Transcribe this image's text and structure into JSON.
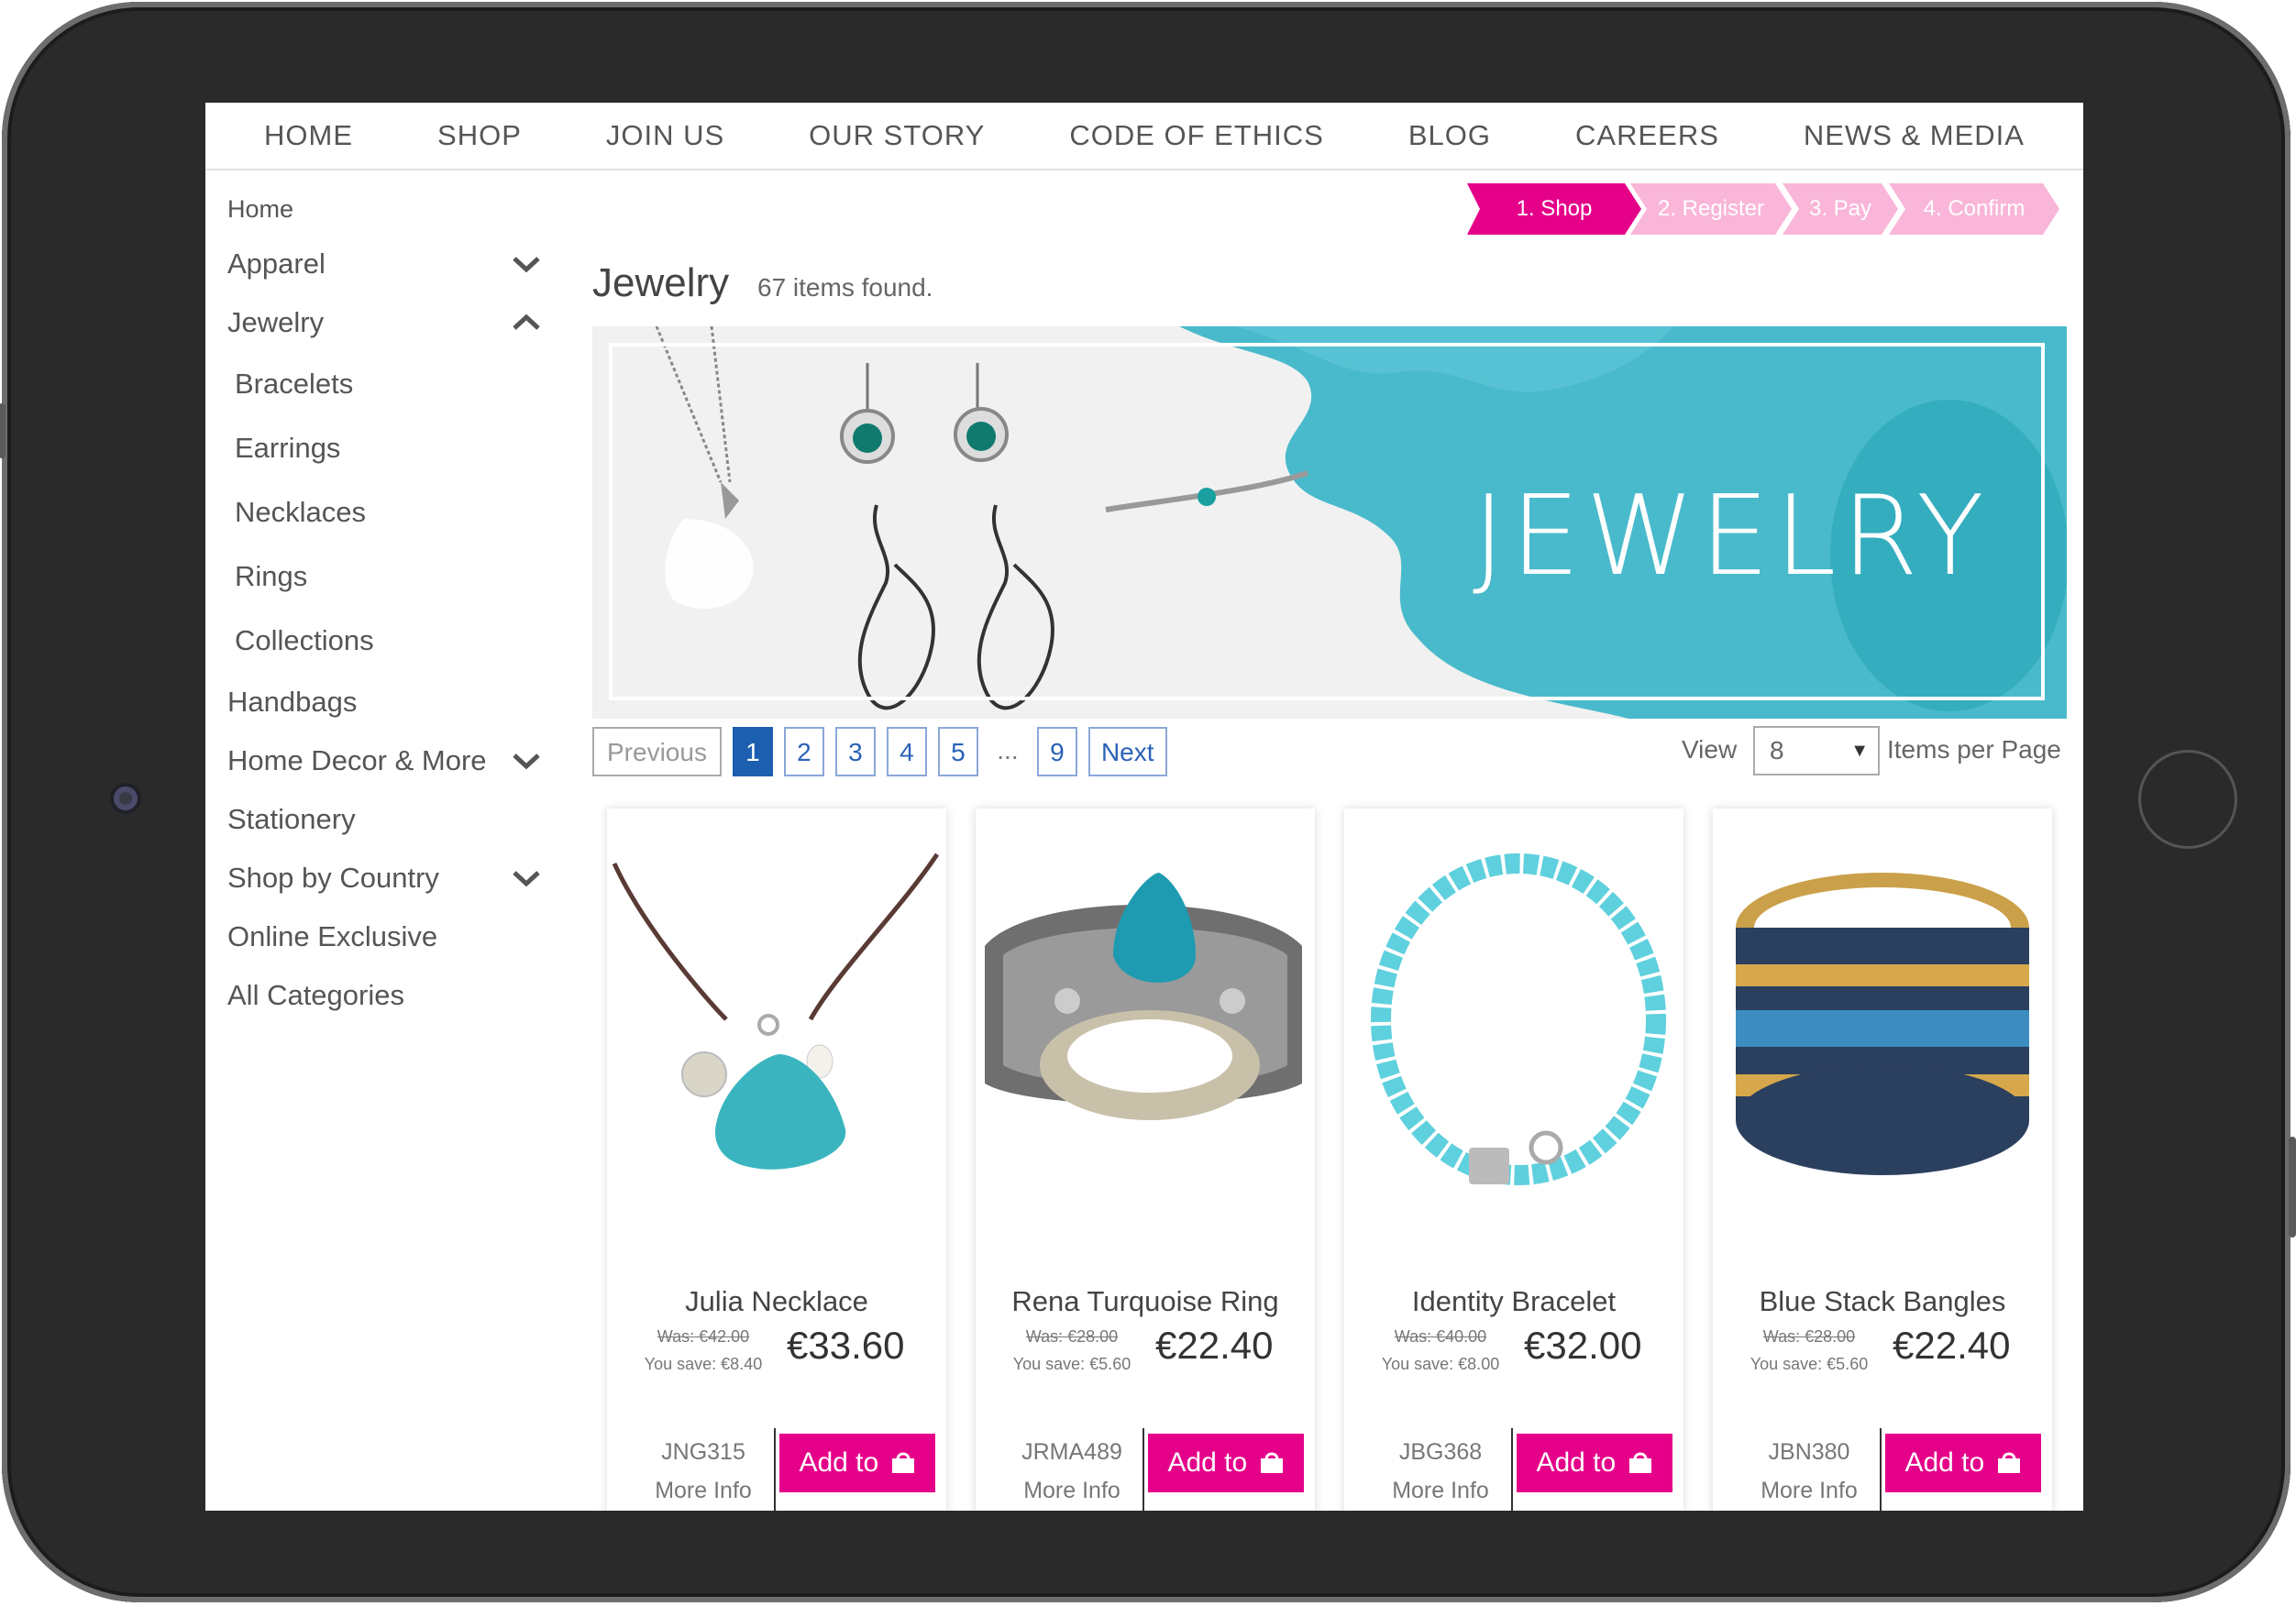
{
  "nav": [
    "HOME",
    "SHOP",
    "JOIN US",
    "OUR STORY",
    "CODE OF ETHICS",
    "BLOG",
    "CAREERS",
    "NEWS & MEDIA"
  ],
  "sidebar": {
    "home": "Home",
    "items": [
      {
        "label": "Apparel",
        "icon": "chevron-down-icon"
      },
      {
        "label": "Jewelry",
        "icon": "chevron-up-icon"
      },
      {
        "label": "Handbags"
      },
      {
        "label": "Home Decor & More",
        "icon": "chevron-down-icon"
      },
      {
        "label": "Stationery"
      },
      {
        "label": "Shop by Country",
        "icon": "chevron-down-icon"
      },
      {
        "label": "Online Exclusive"
      },
      {
        "label": "All Categories"
      }
    ],
    "jewelry_sub": [
      "Bracelets",
      "Earrings",
      "Necklaces",
      "Rings",
      "Collections"
    ]
  },
  "steps": [
    "1. Shop",
    "2. Register",
    "3. Pay",
    "4. Confirm"
  ],
  "colors": {
    "accent": "#e5008a",
    "accent_light": "#f9b6d9",
    "link": "#1c5fb0",
    "banner_teal": "#2bb0c4"
  },
  "main": {
    "title": "Jewelry",
    "count": "67 items found.",
    "banner_text": "JEWELRY"
  },
  "pagination": {
    "previous": "Previous",
    "pages": [
      "1",
      "2",
      "3",
      "4",
      "5"
    ],
    "ellipsis": "...",
    "last": "9",
    "next": "Next",
    "current": "1"
  },
  "view": {
    "label": "View",
    "value": "8",
    "suffix": "Items per Page"
  },
  "products": [
    {
      "name": "Julia Necklace",
      "was": "Was: €42.00",
      "save": "You save: €8.40",
      "price": "€33.60",
      "sku": "JNG315",
      "more": "More Info",
      "add": "Add to"
    },
    {
      "name": "Rena Turquoise Ring",
      "was": "Was: €28.00",
      "save": "You save: €5.60",
      "price": "€22.40",
      "sku": "JRMA489",
      "more": "More Info",
      "add": "Add to"
    },
    {
      "name": "Identity Bracelet",
      "was": "Was: €40.00",
      "save": "You save: €8.00",
      "price": "€32.00",
      "sku": "JBG368",
      "more": "More Info",
      "add": "Add to"
    },
    {
      "name": "Blue Stack Bangles",
      "was": "Was: €28.00",
      "save": "You save: €5.60",
      "price": "€22.40",
      "sku": "JBN380",
      "more": "More Info",
      "add": "Add to"
    }
  ]
}
